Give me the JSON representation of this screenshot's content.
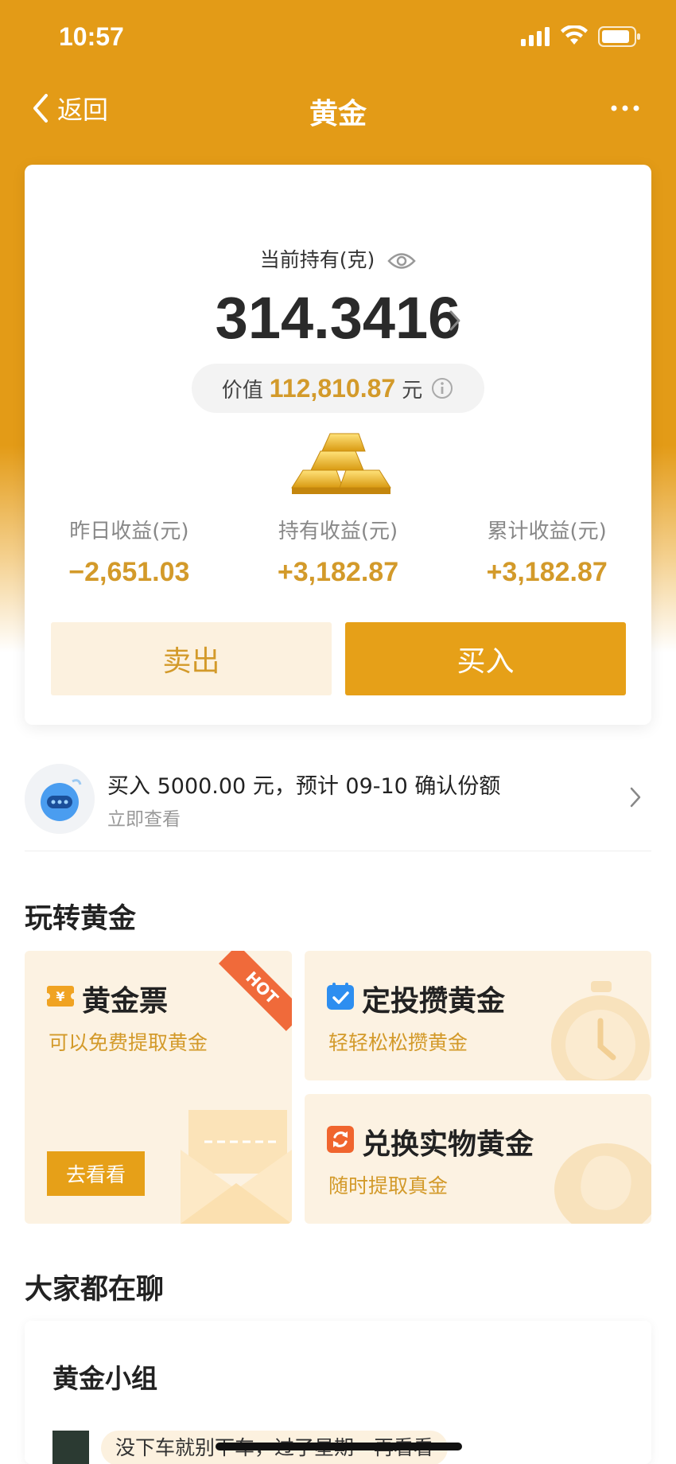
{
  "status_bar": {
    "time": "10:57"
  },
  "nav": {
    "back_label": "返回",
    "title": "黄金"
  },
  "holding": {
    "label": "当前持有(克)",
    "amount": "314.3416",
    "value_prefix": "价值",
    "value_amount": "112,810.87",
    "value_unit": "元"
  },
  "stats": [
    {
      "label": "昨日收益(元)",
      "value": "−2,651.03"
    },
    {
      "label": "持有收益(元)",
      "value": "+3,182.87"
    },
    {
      "label": "累计收益(元)",
      "value": "+3,182.87"
    }
  ],
  "actions": {
    "sell_label": "卖出",
    "buy_label": "买入"
  },
  "notice": {
    "title": "买入 5000.00 元，预计 09-10 确认份额",
    "subtitle": "立即查看"
  },
  "play_gold": {
    "section_title": "玩转黄金",
    "ticket": {
      "title": "黄金票",
      "subtitle": "可以免费提取黄金",
      "badge": "HOT",
      "button": "去看看",
      "icon": "yen-ticket-icon"
    },
    "invest": {
      "title": "定投攒黄金",
      "subtitle": "轻轻松松攒黄金",
      "icon": "calendar-check-icon"
    },
    "exchange": {
      "title": "兑换实物黄金",
      "subtitle": "随时提取真金",
      "icon": "exchange-icon"
    }
  },
  "chat": {
    "section_title": "大家都在聊",
    "group_title": "黄金小组",
    "message": "没下车就别下车，过了星期一再看看"
  },
  "colors": {
    "brand": "#e39b17",
    "accent_text": "#d39a2a",
    "buy_button": "#e6a018",
    "sell_button_bg": "#fcf1df",
    "card_bg": "#fcf2e2",
    "hot_badge": "#f06a3a"
  }
}
